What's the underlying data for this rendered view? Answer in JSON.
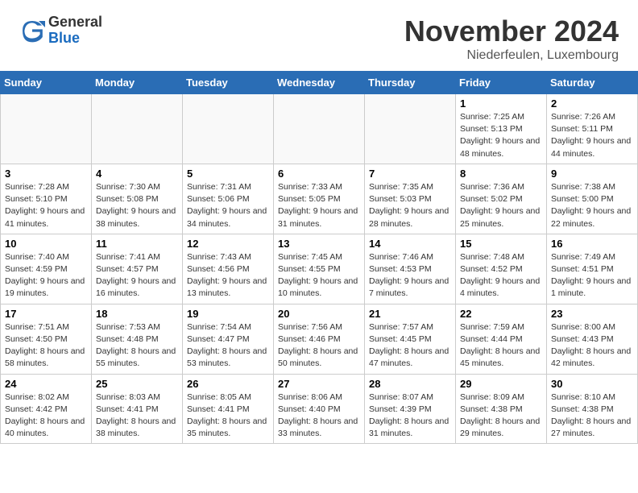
{
  "header": {
    "logo_general": "General",
    "logo_blue": "Blue",
    "month_title": "November 2024",
    "location": "Niederfeulen, Luxembourg"
  },
  "calendar": {
    "days_of_week": [
      "Sunday",
      "Monday",
      "Tuesday",
      "Wednesday",
      "Thursday",
      "Friday",
      "Saturday"
    ],
    "weeks": [
      [
        {
          "day": "",
          "info": ""
        },
        {
          "day": "",
          "info": ""
        },
        {
          "day": "",
          "info": ""
        },
        {
          "day": "",
          "info": ""
        },
        {
          "day": "",
          "info": ""
        },
        {
          "day": "1",
          "info": "Sunrise: 7:25 AM\nSunset: 5:13 PM\nDaylight: 9 hours and 48 minutes."
        },
        {
          "day": "2",
          "info": "Sunrise: 7:26 AM\nSunset: 5:11 PM\nDaylight: 9 hours and 44 minutes."
        }
      ],
      [
        {
          "day": "3",
          "info": "Sunrise: 7:28 AM\nSunset: 5:10 PM\nDaylight: 9 hours and 41 minutes."
        },
        {
          "day": "4",
          "info": "Sunrise: 7:30 AM\nSunset: 5:08 PM\nDaylight: 9 hours and 38 minutes."
        },
        {
          "day": "5",
          "info": "Sunrise: 7:31 AM\nSunset: 5:06 PM\nDaylight: 9 hours and 34 minutes."
        },
        {
          "day": "6",
          "info": "Sunrise: 7:33 AM\nSunset: 5:05 PM\nDaylight: 9 hours and 31 minutes."
        },
        {
          "day": "7",
          "info": "Sunrise: 7:35 AM\nSunset: 5:03 PM\nDaylight: 9 hours and 28 minutes."
        },
        {
          "day": "8",
          "info": "Sunrise: 7:36 AM\nSunset: 5:02 PM\nDaylight: 9 hours and 25 minutes."
        },
        {
          "day": "9",
          "info": "Sunrise: 7:38 AM\nSunset: 5:00 PM\nDaylight: 9 hours and 22 minutes."
        }
      ],
      [
        {
          "day": "10",
          "info": "Sunrise: 7:40 AM\nSunset: 4:59 PM\nDaylight: 9 hours and 19 minutes."
        },
        {
          "day": "11",
          "info": "Sunrise: 7:41 AM\nSunset: 4:57 PM\nDaylight: 9 hours and 16 minutes."
        },
        {
          "day": "12",
          "info": "Sunrise: 7:43 AM\nSunset: 4:56 PM\nDaylight: 9 hours and 13 minutes."
        },
        {
          "day": "13",
          "info": "Sunrise: 7:45 AM\nSunset: 4:55 PM\nDaylight: 9 hours and 10 minutes."
        },
        {
          "day": "14",
          "info": "Sunrise: 7:46 AM\nSunset: 4:53 PM\nDaylight: 9 hours and 7 minutes."
        },
        {
          "day": "15",
          "info": "Sunrise: 7:48 AM\nSunset: 4:52 PM\nDaylight: 9 hours and 4 minutes."
        },
        {
          "day": "16",
          "info": "Sunrise: 7:49 AM\nSunset: 4:51 PM\nDaylight: 9 hours and 1 minute."
        }
      ],
      [
        {
          "day": "17",
          "info": "Sunrise: 7:51 AM\nSunset: 4:50 PM\nDaylight: 8 hours and 58 minutes."
        },
        {
          "day": "18",
          "info": "Sunrise: 7:53 AM\nSunset: 4:48 PM\nDaylight: 8 hours and 55 minutes."
        },
        {
          "day": "19",
          "info": "Sunrise: 7:54 AM\nSunset: 4:47 PM\nDaylight: 8 hours and 53 minutes."
        },
        {
          "day": "20",
          "info": "Sunrise: 7:56 AM\nSunset: 4:46 PM\nDaylight: 8 hours and 50 minutes."
        },
        {
          "day": "21",
          "info": "Sunrise: 7:57 AM\nSunset: 4:45 PM\nDaylight: 8 hours and 47 minutes."
        },
        {
          "day": "22",
          "info": "Sunrise: 7:59 AM\nSunset: 4:44 PM\nDaylight: 8 hours and 45 minutes."
        },
        {
          "day": "23",
          "info": "Sunrise: 8:00 AM\nSunset: 4:43 PM\nDaylight: 8 hours and 42 minutes."
        }
      ],
      [
        {
          "day": "24",
          "info": "Sunrise: 8:02 AM\nSunset: 4:42 PM\nDaylight: 8 hours and 40 minutes."
        },
        {
          "day": "25",
          "info": "Sunrise: 8:03 AM\nSunset: 4:41 PM\nDaylight: 8 hours and 38 minutes."
        },
        {
          "day": "26",
          "info": "Sunrise: 8:05 AM\nSunset: 4:41 PM\nDaylight: 8 hours and 35 minutes."
        },
        {
          "day": "27",
          "info": "Sunrise: 8:06 AM\nSunset: 4:40 PM\nDaylight: 8 hours and 33 minutes."
        },
        {
          "day": "28",
          "info": "Sunrise: 8:07 AM\nSunset: 4:39 PM\nDaylight: 8 hours and 31 minutes."
        },
        {
          "day": "29",
          "info": "Sunrise: 8:09 AM\nSunset: 4:38 PM\nDaylight: 8 hours and 29 minutes."
        },
        {
          "day": "30",
          "info": "Sunrise: 8:10 AM\nSunset: 4:38 PM\nDaylight: 8 hours and 27 minutes."
        }
      ]
    ]
  }
}
